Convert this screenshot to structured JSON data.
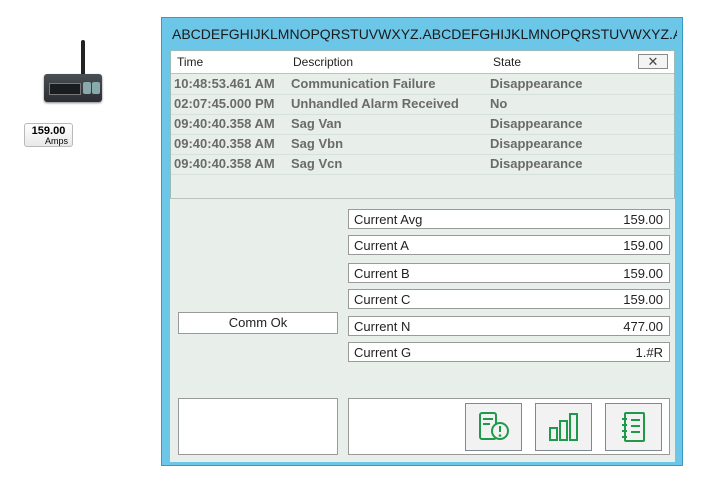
{
  "device_tag": {
    "value": "159.00",
    "unit": "Amps"
  },
  "popup": {
    "title": "ABCDEFGHIJKLMNOPQRSTUVWXYZ.ABCDEFGHIJKLMNOPQRSTUVWXYZ.A...",
    "alarm_grid": {
      "columns": {
        "time": "Time",
        "description": "Description",
        "state": "State"
      },
      "close_label": "✕",
      "rows": [
        {
          "time": "10:48:53.461 AM",
          "description": "Communication Failure",
          "state": "Disappearance"
        },
        {
          "time": "02:07:45.000 PM",
          "description": "Unhandled Alarm Received",
          "state": "No"
        },
        {
          "time": "09:40:40.358 AM",
          "description": "Sag Van",
          "state": "Disappearance"
        },
        {
          "time": "09:40:40.358 AM",
          "description": "Sag Vbn",
          "state": "Disappearance"
        },
        {
          "time": "09:40:40.358 AM",
          "description": "Sag Vcn",
          "state": "Disappearance"
        }
      ]
    },
    "comm_status": "Comm Ok",
    "readings": [
      {
        "label": "Current Avg",
        "value": "159.00"
      },
      {
        "label": "Current A",
        "value": "159.00"
      },
      {
        "label": "Current B",
        "value": "159.00"
      },
      {
        "label": "Current C",
        "value": "159.00"
      },
      {
        "label": "Current N",
        "value": "477.00"
      },
      {
        "label": "Current G",
        "value": "1.#R"
      }
    ],
    "buttons": [
      {
        "icon": "device-alarm-icon"
      },
      {
        "icon": "bar-chart-icon"
      },
      {
        "icon": "notebook-icon"
      }
    ],
    "accent_color": "#1f9a4a",
    "panel_color": "#6cc6e8"
  }
}
